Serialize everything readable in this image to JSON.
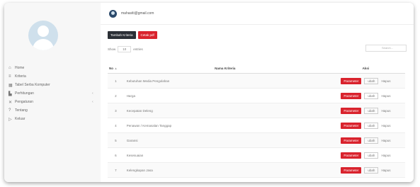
{
  "user": {
    "email": "mahasiti@gmail.com"
  },
  "sidebar": {
    "items": [
      {
        "icon": "home-icon",
        "glyph": "⌂",
        "label": "Home"
      },
      {
        "icon": "list-icon",
        "glyph": "≡",
        "label": "Kriteria"
      },
      {
        "icon": "table-icon",
        "glyph": "▦",
        "label": "Tabel Serba Komputer"
      },
      {
        "icon": "chart-icon",
        "glyph": "▙",
        "label": "Perhitungan",
        "chevron": "‹"
      },
      {
        "icon": "settings-icon",
        "glyph": "✕",
        "label": "Pengaturan",
        "chevron": "‹"
      },
      {
        "icon": "help-icon",
        "glyph": "?",
        "label": "Tentang"
      },
      {
        "icon": "logout-icon",
        "glyph": "▷",
        "label": "Keluar"
      }
    ]
  },
  "toolbar": {
    "add_label": "Tambah Kriteria",
    "print_label": "Cetak pdf"
  },
  "controls": {
    "show_label": "Show",
    "entries_value": "10",
    "entries_label": "entries",
    "search_label": "",
    "search_placeholder": "Search..."
  },
  "table": {
    "headers": {
      "no": "No",
      "sort": "▲",
      "name": "Nama Kriteria",
      "aksi": "Aksi"
    },
    "rows": [
      {
        "no": "1",
        "name": "Kebutuhan Media Pengolahan"
      },
      {
        "no": "2",
        "name": "Harga"
      },
      {
        "no": "3",
        "name": "Kecepatan Deleng"
      },
      {
        "no": "4",
        "name": "Penawan / Kemasalan Tanggap"
      },
      {
        "no": "5",
        "name": "Garansi"
      },
      {
        "no": "6",
        "name": "Kesesuaian"
      },
      {
        "no": "7",
        "name": "Kelengkapan Jasa"
      },
      {
        "no": "8",
        "name": "Jarak"
      }
    ],
    "actions": {
      "parameter": "Parameter",
      "ubah": "ubah",
      "hapus": "Hapus"
    }
  }
}
